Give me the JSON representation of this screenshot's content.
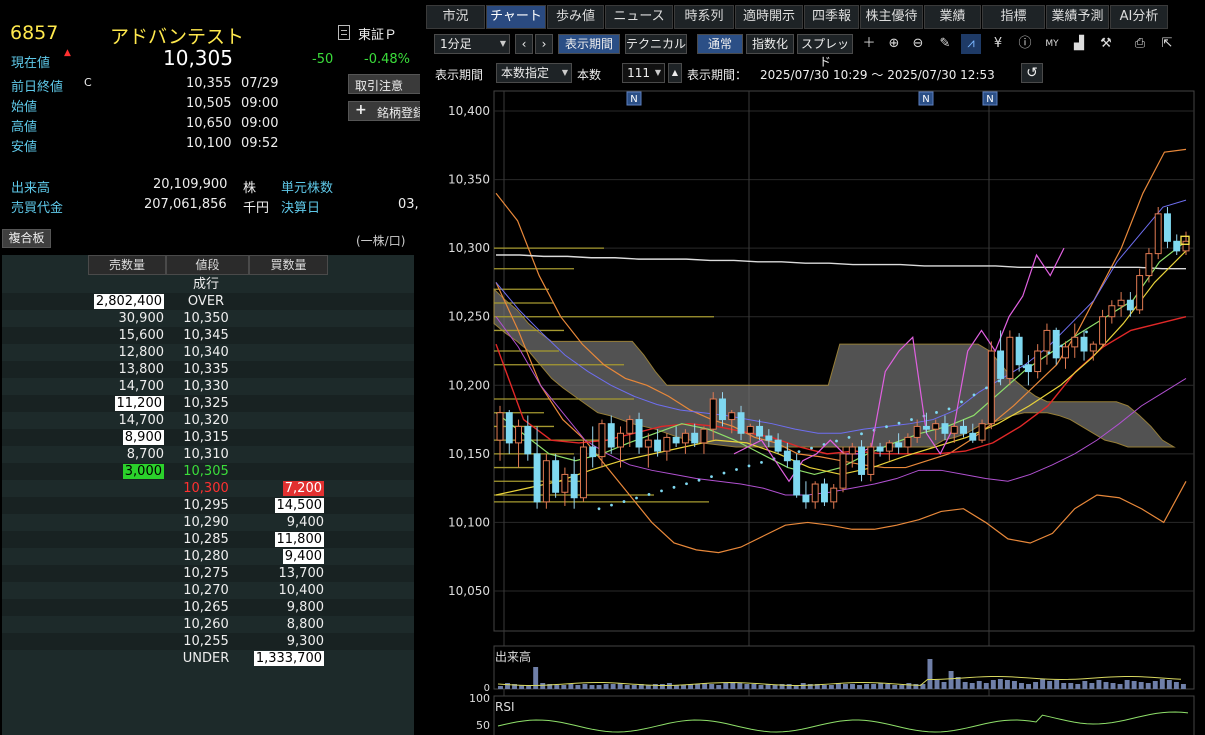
{
  "stock": {
    "code": "6857",
    "name": "アドバンテスト",
    "exchange": "東証Ｐ",
    "current_label": "現在値",
    "current": "10,305",
    "change": "-50",
    "change_pct": "-0.48%",
    "prev_close_label": "前日終値",
    "prev_close_flag": "C",
    "prev_close": "10,355",
    "prev_close_date": "07/29",
    "open_label": "始値",
    "open": "10,505",
    "open_time": "09:00",
    "high_label": "高値",
    "high": "10,650",
    "high_time": "09:00",
    "low_label": "安値",
    "low": "10,100",
    "low_time": "09:52",
    "volume_label": "出来高",
    "volume": "20,109,900",
    "volume_unit": "株",
    "turnover_label": "売買代金",
    "turnover": "207,061,856",
    "turnover_unit": "千円",
    "unit_label": "単元株数",
    "settle_label": "決算日",
    "settle_value": "03,"
  },
  "side_buttons": {
    "notice": "取引注意",
    "register": "銘柄登録"
  },
  "book": {
    "button": "複合板",
    "unit_note": "(一株/口)",
    "headers": {
      "sell": "売数量",
      "price": "値段",
      "buy": "買数量"
    },
    "market_label": "成行",
    "rows": [
      {
        "sell": "2,802,400",
        "price": "OVER",
        "buy": "",
        "sh": "w"
      },
      {
        "sell": "30,900",
        "price": "10,350",
        "buy": ""
      },
      {
        "sell": "15,600",
        "price": "10,345",
        "buy": ""
      },
      {
        "sell": "12,800",
        "price": "10,340",
        "buy": ""
      },
      {
        "sell": "13,800",
        "price": "10,335",
        "buy": ""
      },
      {
        "sell": "14,700",
        "price": "10,330",
        "buy": ""
      },
      {
        "sell": "11,200",
        "price": "10,325",
        "buy": "",
        "sh": "w"
      },
      {
        "sell": "14,700",
        "price": "10,320",
        "buy": ""
      },
      {
        "sell": "8,900",
        "price": "10,315",
        "buy": "",
        "sh": "w"
      },
      {
        "sell": "8,700",
        "price": "10,310",
        "buy": ""
      },
      {
        "sell": "3,000",
        "price": "10,305",
        "buy": "",
        "sh": "g",
        "pc": "cur"
      },
      {
        "sell": "",
        "price": "10,300",
        "buy": "7,200",
        "bh": "r",
        "pc": "red"
      },
      {
        "sell": "",
        "price": "10,295",
        "buy": "14,500",
        "bh": "w"
      },
      {
        "sell": "",
        "price": "10,290",
        "buy": "9,400"
      },
      {
        "sell": "",
        "price": "10,285",
        "buy": "11,800",
        "bh": "w"
      },
      {
        "sell": "",
        "price": "10,280",
        "buy": "9,400",
        "bh": "w"
      },
      {
        "sell": "",
        "price": "10,275",
        "buy": "13,700"
      },
      {
        "sell": "",
        "price": "10,270",
        "buy": "10,400"
      },
      {
        "sell": "",
        "price": "10,265",
        "buy": "9,800"
      },
      {
        "sell": "",
        "price": "10,260",
        "buy": "8,800"
      },
      {
        "sell": "",
        "price": "10,255",
        "buy": "9,300"
      },
      {
        "sell": "",
        "price": "UNDER",
        "buy": "1,333,700",
        "bh": "w"
      }
    ]
  },
  "tabs": [
    "市況",
    "チャート",
    "歩み値",
    "ニュース",
    "時系列",
    "適時開示",
    "四季報",
    "株主優待",
    "業績",
    "指標",
    "業績予測",
    "AI分析"
  ],
  "active_tab": 1,
  "toolbar": {
    "interval": "1分足",
    "period_btn": "表示期間",
    "technical_btn": "テクニカル",
    "normal_btn": "通常",
    "index_btn": "指数化",
    "spread_btn": "スプレッド",
    "period_label": "表示期間",
    "period_mode": "本数指定",
    "bars_label": "本数",
    "bars_value": "111",
    "range_label": "表示期間：",
    "range_value": "2025/07/30 10:29 ～ 2025/07/30 12:53"
  },
  "icons": [
    "prev-icon",
    "next-icon",
    "crosshair-icon",
    "zoom-in-icon",
    "zoom-out-icon",
    "pencil-icon",
    "trendline-icon",
    "yen-icon",
    "info-icon",
    "my-icon",
    "volume-profile-icon",
    "settings-wrench-icon",
    "print-icon",
    "popout-icon",
    "reset-icon"
  ],
  "chart_data": {
    "type": "line",
    "ylabels": [
      "10,400",
      "10,350",
      "10,300",
      "10,250",
      "10,200",
      "10,150",
      "10,100",
      "10,050"
    ],
    "ylim": [
      10050,
      10400
    ],
    "news_markers": [
      "N",
      "N",
      "N"
    ],
    "volume_label": "出来高",
    "volume_zero": "0",
    "rsi_label": "RSI",
    "rsi_ticks": [
      "100",
      "50"
    ],
    "candles": [
      {
        "o": 10160,
        "h": 10185,
        "l": 10145,
        "c": 10180
      },
      {
        "o": 10180,
        "h": 10182,
        "l": 10150,
        "c": 10158
      },
      {
        "o": 10158,
        "h": 10175,
        "l": 10140,
        "c": 10170
      },
      {
        "o": 10170,
        "h": 10178,
        "l": 10145,
        "c": 10150
      },
      {
        "o": 10150,
        "h": 10170,
        "l": 10110,
        "c": 10115
      },
      {
        "o": 10115,
        "h": 10150,
        "l": 10110,
        "c": 10145
      },
      {
        "o": 10145,
        "h": 10150,
        "l": 10118,
        "c": 10122
      },
      {
        "o": 10122,
        "h": 10140,
        "l": 10112,
        "c": 10135
      },
      {
        "o": 10135,
        "h": 10148,
        "l": 10110,
        "c": 10118
      },
      {
        "o": 10118,
        "h": 10160,
        "l": 10115,
        "c": 10155
      },
      {
        "o": 10155,
        "h": 10170,
        "l": 10140,
        "c": 10148
      },
      {
        "o": 10148,
        "h": 10175,
        "l": 10140,
        "c": 10172
      },
      {
        "o": 10172,
        "h": 10178,
        "l": 10150,
        "c": 10155
      },
      {
        "o": 10155,
        "h": 10170,
        "l": 10140,
        "c": 10165
      },
      {
        "o": 10165,
        "h": 10178,
        "l": 10155,
        "c": 10175
      },
      {
        "o": 10175,
        "h": 10180,
        "l": 10150,
        "c": 10155
      },
      {
        "o": 10155,
        "h": 10165,
        "l": 10140,
        "c": 10160
      },
      {
        "o": 10160,
        "h": 10168,
        "l": 10148,
        "c": 10152
      },
      {
        "o": 10152,
        "h": 10165,
        "l": 10145,
        "c": 10162
      },
      {
        "o": 10162,
        "h": 10170,
        "l": 10155,
        "c": 10158
      },
      {
        "o": 10158,
        "h": 10168,
        "l": 10150,
        "c": 10165
      },
      {
        "o": 10165,
        "h": 10172,
        "l": 10155,
        "c": 10158
      },
      {
        "o": 10158,
        "h": 10170,
        "l": 10150,
        "c": 10168
      },
      {
        "o": 10168,
        "h": 10195,
        "l": 10160,
        "c": 10190
      },
      {
        "o": 10190,
        "h": 10195,
        "l": 10170,
        "c": 10175
      },
      {
        "o": 10175,
        "h": 10182,
        "l": 10165,
        "c": 10180
      },
      {
        "o": 10180,
        "h": 10185,
        "l": 10160,
        "c": 10165
      },
      {
        "o": 10165,
        "h": 10172,
        "l": 10158,
        "c": 10170
      },
      {
        "o": 10170,
        "h": 10175,
        "l": 10160,
        "c": 10163
      },
      {
        "o": 10163,
        "h": 10168,
        "l": 10155,
        "c": 10160
      },
      {
        "o": 10160,
        "h": 10165,
        "l": 10150,
        "c": 10152
      },
      {
        "o": 10152,
        "h": 10158,
        "l": 10140,
        "c": 10145
      },
      {
        "o": 10145,
        "h": 10150,
        "l": 10118,
        "c": 10120
      },
      {
        "o": 10120,
        "h": 10130,
        "l": 10110,
        "c": 10115
      },
      {
        "o": 10115,
        "h": 10130,
        "l": 10110,
        "c": 10128
      },
      {
        "o": 10128,
        "h": 10132,
        "l": 10112,
        "c": 10115
      },
      {
        "o": 10115,
        "h": 10128,
        "l": 10110,
        "c": 10125
      },
      {
        "o": 10125,
        "h": 10155,
        "l": 10122,
        "c": 10150
      },
      {
        "o": 10150,
        "h": 10158,
        "l": 10140,
        "c": 10155
      },
      {
        "o": 10155,
        "h": 10160,
        "l": 10130,
        "c": 10135
      },
      {
        "o": 10135,
        "h": 10158,
        "l": 10130,
        "c": 10155
      },
      {
        "o": 10155,
        "h": 10158,
        "l": 10148,
        "c": 10152
      },
      {
        "o": 10152,
        "h": 10160,
        "l": 10145,
        "c": 10158
      },
      {
        "o": 10158,
        "h": 10165,
        "l": 10150,
        "c": 10155
      },
      {
        "o": 10155,
        "h": 10165,
        "l": 10150,
        "c": 10162
      },
      {
        "o": 10162,
        "h": 10175,
        "l": 10158,
        "c": 10170
      },
      {
        "o": 10170,
        "h": 10180,
        "l": 10165,
        "c": 10168
      },
      {
        "o": 10168,
        "h": 10175,
        "l": 10160,
        "c": 10172
      },
      {
        "o": 10172,
        "h": 10178,
        "l": 10160,
        "c": 10165
      },
      {
        "o": 10165,
        "h": 10172,
        "l": 10158,
        "c": 10170
      },
      {
        "o": 10170,
        "h": 10175,
        "l": 10162,
        "c": 10165
      },
      {
        "o": 10165,
        "h": 10172,
        "l": 10158,
        "c": 10160
      },
      {
        "o": 10160,
        "h": 10175,
        "l": 10158,
        "c": 10172
      },
      {
        "o": 10172,
        "h": 10232,
        "l": 10168,
        "c": 10225
      },
      {
        "o": 10225,
        "h": 10240,
        "l": 10200,
        "c": 10205
      },
      {
        "o": 10205,
        "h": 10240,
        "l": 10200,
        "c": 10235
      },
      {
        "o": 10235,
        "h": 10238,
        "l": 10210,
        "c": 10215
      },
      {
        "o": 10215,
        "h": 10222,
        "l": 10200,
        "c": 10210
      },
      {
        "o": 10210,
        "h": 10230,
        "l": 10205,
        "c": 10225
      },
      {
        "o": 10225,
        "h": 10245,
        "l": 10215,
        "c": 10240
      },
      {
        "o": 10240,
        "h": 10242,
        "l": 10215,
        "c": 10220
      },
      {
        "o": 10220,
        "h": 10232,
        "l": 10212,
        "c": 10228
      },
      {
        "o": 10228,
        "h": 10245,
        "l": 10220,
        "c": 10235
      },
      {
        "o": 10235,
        "h": 10240,
        "l": 10218,
        "c": 10225
      },
      {
        "o": 10225,
        "h": 10232,
        "l": 10218,
        "c": 10230
      },
      {
        "o": 10230,
        "h": 10255,
        "l": 10228,
        "c": 10250
      },
      {
        "o": 10250,
        "h": 10262,
        "l": 10245,
        "c": 10258
      },
      {
        "o": 10258,
        "h": 10268,
        "l": 10250,
        "c": 10262
      },
      {
        "o": 10262,
        "h": 10268,
        "l": 10250,
        "c": 10255
      },
      {
        "o": 10255,
        "h": 10285,
        "l": 10252,
        "c": 10280
      },
      {
        "o": 10280,
        "h": 10300,
        "l": 10275,
        "c": 10296
      },
      {
        "o": 10296,
        "h": 10330,
        "l": 10292,
        "c": 10325
      },
      {
        "o": 10325,
        "h": 10330,
        "l": 10300,
        "c": 10305
      },
      {
        "o": 10305,
        "h": 10310,
        "l": 10295,
        "c": 10298
      },
      {
        "o": 10298,
        "h": 10312,
        "l": 10295,
        "c": 10305
      }
    ]
  },
  "colors": {
    "bull": "#e07a52",
    "bear": "#7fd8f0",
    "cloud": "#6e6e6e",
    "accent_tab": "#2a4a80"
  }
}
